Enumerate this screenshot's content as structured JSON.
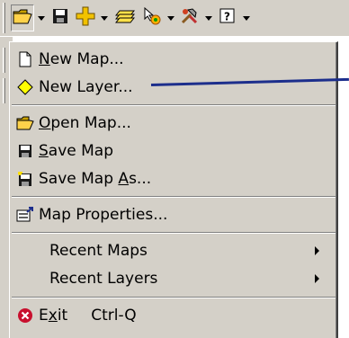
{
  "toolbar": {
    "buttons": [
      {
        "icon": "open-folder-icon",
        "pressed": true
      },
      {
        "icon": "save-disk-icon"
      },
      {
        "icon": "add-data-icon"
      },
      {
        "icon": "layers-icon"
      },
      {
        "icon": "pointer-target-icon"
      },
      {
        "icon": "tools-icon"
      },
      {
        "icon": "help-icon"
      }
    ]
  },
  "file_menu": {
    "items": [
      {
        "label_prefix": "",
        "mnemonic": "N",
        "label_rest": "ew Map...",
        "icon": "blank-page-icon"
      },
      {
        "label": "New Layer...",
        "icon": "diamond-layer-icon"
      },
      {
        "label_prefix": "",
        "mnemonic": "O",
        "label_rest": "pen Map...",
        "icon": "open-folder-icon"
      },
      {
        "label_prefix": "",
        "mnemonic": "S",
        "label_rest": "ave Map",
        "icon": "save-disk-icon"
      },
      {
        "label_prefix": "Save Map ",
        "mnemonic": "A",
        "label_rest": "s...",
        "icon": "save-as-icon"
      },
      {
        "label": "Map Properties...",
        "icon": "properties-icon"
      },
      {
        "label": "Recent Maps",
        "submenu": true
      },
      {
        "label": "Recent Layers",
        "submenu": true
      },
      {
        "label_prefix": "E",
        "mnemonic": "x",
        "label_rest": "it",
        "shortcut": "Ctrl-Q",
        "icon": "exit-icon"
      }
    ]
  },
  "colors": {
    "menu_bg": "#d4d0c8",
    "callout_line": "#1c2e8c",
    "exit_red": "#c8102e",
    "diamond_yellow": "#ffff00"
  }
}
